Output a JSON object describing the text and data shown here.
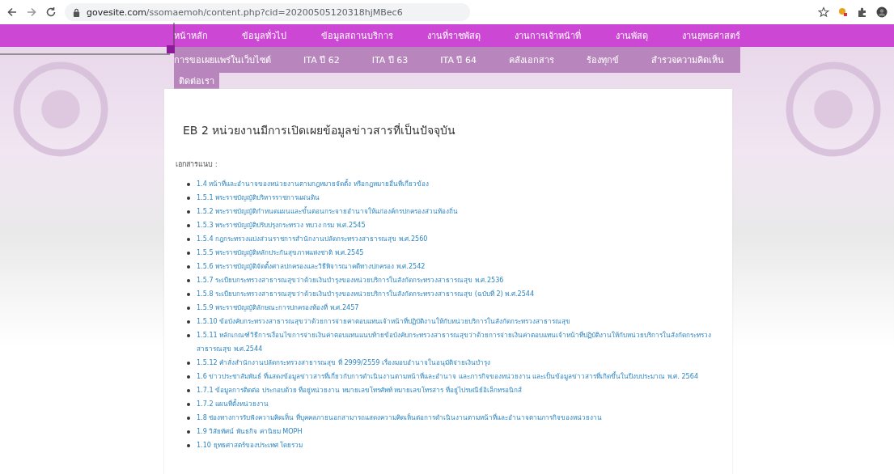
{
  "browser": {
    "url_host": "govesite.com",
    "url_path": "/ssomaemoh/content.php?cid=20200505120318hjMBec6"
  },
  "nav_rows": [
    [
      "หน้าหลัก",
      "ข้อมูลทั่วไป",
      "ข้อมูลสถานบริการ",
      "งานที่ราชพัสดุ",
      "งานการเจ้าหน้าที่",
      "งานพัสดุ",
      "งานยุทธศาสตร์"
    ],
    [
      "การขอเผยแพร่ในเว็บไซต์",
      "ITA ปี 62",
      "ITA ปี 63",
      "ITA ปี 64",
      "คลังเอกสาร",
      "ร้องทุกข์",
      "สำรวจความคิดเห็น"
    ],
    [
      "ติดต่อเรา"
    ]
  ],
  "content": {
    "title": "EB 2 หน่วยงานมีการเปิดเผยข้อมูลข่าวสารที่เป็นปัจจุบัน",
    "attachments_label": "เอกสารแนบ :",
    "attachments": [
      "1.4 หน้าที่และอำนาจของหน่วยงานตามกฎหมายจัดตั้ง หรือกฎหมายอื่นที่เกี่ยวข้อง",
      "1.5.1 พระราชบัญญัติบริหารราชการแผ่นดิน",
      "1.5.2 พระราชบัญญัติกำหนดแผนและขั้นตอนกระจายอำนาจให้แก่องค์กรปกครองส่วนท้องถิ่น",
      "1.5.3 พระราชบัญญัติปรับปรุงกระทรวง ทบวง กรม พ.ศ.2545",
      "1.5.4 กฎกระทรวงแบ่งส่วนราชการสำนักงานปลัดกระทรวงสาธารณสุข พ.ศ.2560",
      "1.5.5 พระราชบัญญัติหลักประกันสุขภาพแห่งชาติ พ.ศ.2545",
      "1.5.6 พระราชบัญญัติจัดตั้งศาลปกครองและวิธีพิจารณาคดีทางปกครอง พ.ศ.2542",
      "1.5.7 ระเบียบกระทรวงสาธารณสุขว่าด้วยเงินบำรุงของหน่วยบริการในสังกัดกระทรวงสาธารณสุข พ.ศ.2536",
      "1.5.8 ระเบียบกระทรวงสาธารณสุขว่าด้วยเงินบำรุงของหน่วยบริการในสังกัดกระทรวงสาธารณสุข (ฉบับที่ 2) พ.ศ.2544",
      "1.5.9 พระราชบัญญัติลักษณะการปกครองท้องที่ พ.ศ.2457",
      "1.5.10 ข้อบังคับกระทรวงสาธารณสุขว่าด้วยการจ่ายค่าตอบแทนเจ้าหน้าที่ปฏิบัติงานให้กับหน่วยบริการในสังกัดกระทรวงสาธารณสุข",
      "1.5.11 หลักเกณฑ์วิธีการเงื่อนไขการจ่ายเงินค่าตอบแทนแนบท้ายข้อบังคับกระทรวงสาธารณสุขว่าด้วยการจ่ายเงินค่าตอบแทนเจ้าหน้าที่ปฏิบัติงานให้กับหน่วยบริการในสังกัดกระทรวงสาธารณสุข พ.ศ.2544",
      "1.5.12 คำสั่งสำนักงานปลัดกระทรวงสาธารณสุข ที่ 2999/2559 เรื่องมอบอำนาจในอนุมัติจ่ายเงินบำรุง",
      "1.6 ข่าวประชาสัมพันธ์ ที่แสดงข้อมูลข่าวสารที่เกี่ยวกับการดำเนินงานตามหน้าที่และอำนาจ และภารกิจของหน่วยงาน และเป็นข้อมูลข่าวสารที่เกิดขึ้นในปีงบประมาณ พ.ศ. 2564",
      "1.7.1 ข้อมูลการติดต่อ ประกอบด้วย ที่อยู่หน่วยงาน หมายเลขโทรศัพท์ หมายเลขโทรสาร ที่อยู่ไปรษณีย์อิเล็กทรอนิกส์",
      "1.7.2 แผนที่ตั้งหน่วยงาน",
      "1.8 ช่องทางการรับฟังความคิดเห็น ที่บุคคลภายนอกสามารถแสดงความคิดเห็นต่อการดำเนินงานตามหน้าที่และอำนาจตามภารกิจของหน่วยงาน",
      "1.9 วิสัยทัศน์ พันธกิจ ค่านิยม MOPH",
      "1.10 ยุทธศาสตร์ของประเทศ โดยรวม"
    ]
  }
}
